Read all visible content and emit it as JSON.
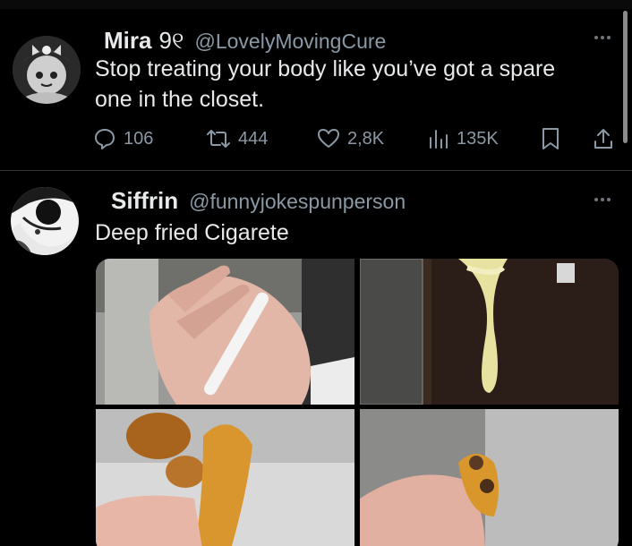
{
  "tweets": [
    {
      "display_name": "Mira",
      "name_suffix": "9୧",
      "handle": "@LovelyMovingCure",
      "text": "Stop treating your body like you’ve got a spare one in the closet.",
      "stats": {
        "replies": "106",
        "reposts": "444",
        "likes": "2,8K",
        "views": "135K"
      }
    },
    {
      "display_name": "Siffrin",
      "handle": "@funnyjokespunperson",
      "text": "Deep fried Cigarete"
    }
  ],
  "icons": {
    "reply": "reply-icon",
    "repost": "repost-icon",
    "like": "heart-icon",
    "views": "views-icon",
    "bookmark": "bookmark-icon",
    "share": "share-icon",
    "more": "more-icon"
  },
  "colors": {
    "background": "#000000",
    "text_primary": "#e7e9ea",
    "text_secondary": "#8b98a5",
    "divider": "#2f3336"
  }
}
